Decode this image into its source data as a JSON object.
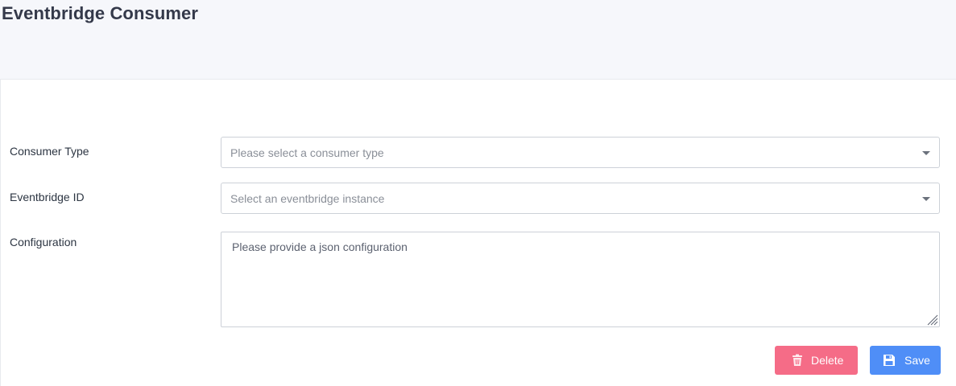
{
  "page": {
    "title": "Eventbridge Consumer"
  },
  "form": {
    "consumer_type": {
      "label": "Consumer Type",
      "placeholder": "Please select a consumer type"
    },
    "eventbridge_id": {
      "label": "Eventbridge ID",
      "placeholder": "Select an eventbridge instance"
    },
    "configuration": {
      "label": "Configuration",
      "placeholder": "Please provide a json configuration"
    }
  },
  "actions": {
    "delete_label": "Delete",
    "save_label": "Save",
    "delete_icon": "trash-icon",
    "save_icon": "floppy-disk-icon"
  },
  "colors": {
    "delete": "#f56c87",
    "save": "#4f8ef7",
    "page_background": "#f6f7fb"
  }
}
